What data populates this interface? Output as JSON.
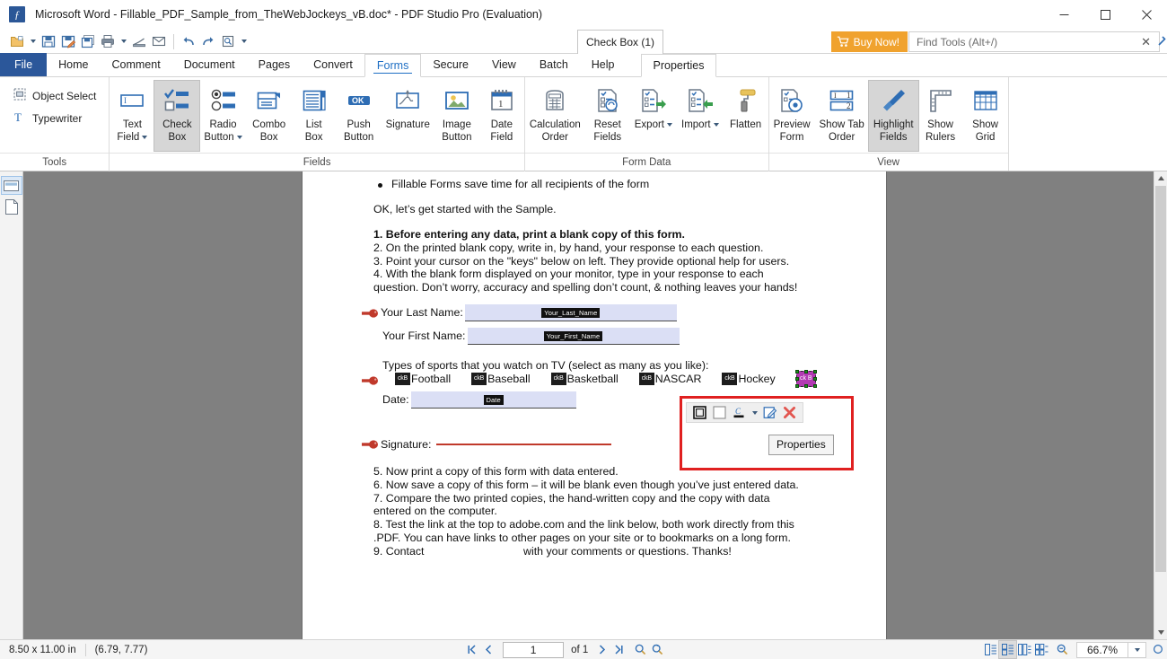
{
  "window": {
    "title": "Microsoft Word - Fillable_PDF_Sample_from_TheWebJockeys_vB.doc* - PDF Studio Pro (Evaluation)",
    "logo_glyph": "ƒ",
    "minimize": "─",
    "maximize": "□",
    "close": "✕"
  },
  "quick_access": {
    "buttons": [
      {
        "name": "open-file",
        "icon": "folder-open-icon"
      },
      {
        "name": "open-file-dropdown",
        "icon": "chevron-down-icon"
      },
      {
        "name": "save",
        "icon": "save-icon"
      },
      {
        "name": "save-as",
        "icon": "save-as-icon"
      },
      {
        "name": "save-all",
        "icon": "save-all-icon"
      },
      {
        "name": "print",
        "icon": "printer-icon"
      },
      {
        "name": "print-dropdown",
        "icon": "chevron-down-icon"
      },
      {
        "name": "scan",
        "icon": "scanner-icon"
      },
      {
        "name": "email",
        "icon": "envelope-icon"
      },
      {
        "name": "undo",
        "icon": "undo-arrow-icon"
      },
      {
        "name": "redo",
        "icon": "redo-arrow-icon"
      },
      {
        "name": "preview",
        "icon": "page-preview-icon"
      },
      {
        "name": "more-dropdown",
        "icon": "chevron-down-icon"
      }
    ],
    "document_selector": "Check Box (1)",
    "buy_now": "Buy Now!",
    "buy_now_color": "#f0a22e",
    "find_tools_placeholder": "Find Tools  (Alt+/)",
    "find_tools_value": "",
    "find_clear": "✕"
  },
  "tabs": {
    "items": [
      {
        "label": "File",
        "state": "file"
      },
      {
        "label": "Home",
        "state": "normal"
      },
      {
        "label": "Comment",
        "state": "normal"
      },
      {
        "label": "Document",
        "state": "normal"
      },
      {
        "label": "Pages",
        "state": "normal"
      },
      {
        "label": "Convert",
        "state": "normal"
      },
      {
        "label": "Forms",
        "state": "active"
      },
      {
        "label": "Secure",
        "state": "normal"
      },
      {
        "label": "View",
        "state": "normal"
      },
      {
        "label": "Batch",
        "state": "normal"
      },
      {
        "label": "Help",
        "state": "normal"
      }
    ],
    "contextual": "Properties",
    "active_accent": "#1f6fc4"
  },
  "ribbon": {
    "groups": [
      {
        "label": "Tools",
        "small_buttons": [
          {
            "label": "Object Select",
            "icon": "object-select-icon"
          },
          {
            "label": "Typewriter",
            "icon": "typewriter-icon"
          }
        ],
        "buttons": []
      },
      {
        "label": "Fields",
        "small_buttons": [],
        "buttons": [
          {
            "label": "Text\nField",
            "icon": "text-field-icon",
            "dropdown": true,
            "selected": false
          },
          {
            "label": "Check\nBox",
            "icon": "check-box-icon",
            "dropdown": false,
            "selected": true
          },
          {
            "label": "Radio\nButton",
            "icon": "radio-button-icon",
            "dropdown": true,
            "selected": false
          },
          {
            "label": "Combo\nBox",
            "icon": "combo-box-icon",
            "dropdown": false,
            "selected": false
          },
          {
            "label": "List\nBox",
            "icon": "list-box-icon",
            "dropdown": false,
            "selected": false
          },
          {
            "label": "Push\nButton",
            "icon": "push-button-icon",
            "dropdown": false,
            "selected": false
          },
          {
            "label": "Signature",
            "icon": "signature-icon",
            "dropdown": false,
            "selected": false
          },
          {
            "label": "Image\nButton",
            "icon": "image-button-icon",
            "dropdown": false,
            "selected": false
          },
          {
            "label": "Date\nField",
            "icon": "date-field-icon",
            "dropdown": false,
            "selected": false
          }
        ]
      },
      {
        "label": "Form Data",
        "small_buttons": [],
        "buttons": [
          {
            "label": "Calculation\nOrder",
            "icon": "calculator-icon",
            "dropdown": false,
            "selected": false
          },
          {
            "label": "Reset\nFields",
            "icon": "reset-fields-icon",
            "dropdown": false,
            "selected": false
          },
          {
            "label": "Export",
            "icon": "export-icon",
            "dropdown": true,
            "selected": false
          },
          {
            "label": "Import",
            "icon": "import-icon",
            "dropdown": true,
            "selected": false
          },
          {
            "label": "Flatten",
            "icon": "flatten-roller-icon",
            "dropdown": false,
            "selected": false
          }
        ]
      },
      {
        "label": "View",
        "small_buttons": [],
        "buttons": [
          {
            "label": "Preview\nForm",
            "icon": "preview-form-icon",
            "dropdown": false,
            "selected": false
          },
          {
            "label": "Show Tab\nOrder",
            "icon": "show-tab-order-icon",
            "dropdown": false,
            "selected": false
          },
          {
            "label": "Highlight\nFields",
            "icon": "highlighter-icon",
            "dropdown": false,
            "selected": true
          },
          {
            "label": "Show\nRulers",
            "icon": "ruler-icon",
            "dropdown": false,
            "selected": false
          },
          {
            "label": "Show\nGrid",
            "icon": "grid-icon",
            "dropdown": false,
            "selected": false
          }
        ]
      }
    ]
  },
  "sidebar_rail": [
    {
      "name": "bookmarks-panel",
      "icon": "panel-icon",
      "active": true
    },
    {
      "name": "pages-panel",
      "icon": "page-icon",
      "active": false
    }
  ],
  "document": {
    "bullet": "Fillable Forms save time for all recipients of the form",
    "intro": "OK, let’s get started with the Sample.",
    "steps_a": [
      "1. Before entering any data, print a blank copy of this form.",
      "2. On the printed blank copy, write in, by hand, your response to each question.",
      "3. Point your cursor on the \"keys\" below on left. They provide optional help for users.",
      "4. With the blank form displayed on your monitor, type in your response to each",
      "    question. Don’t worry, accuracy and spelling don’t count, & nothing leaves your hands!"
    ],
    "fields": [
      {
        "label": "Your Last Name:",
        "field_name": "Your_Last_Name",
        "has_key": true
      },
      {
        "label": "Your First Name:",
        "field_name": "Your_First_Name",
        "has_key": false
      }
    ],
    "sports_prompt": "Types of sports that you watch on TV (select as many as you like):",
    "sports": [
      {
        "label": "Football",
        "box_text": "ckB"
      },
      {
        "label": "Baseball",
        "box_text": "ckB"
      },
      {
        "label": "Basketball",
        "box_text": "ckB"
      },
      {
        "label": "NASCAR",
        "box_text": "ckB"
      },
      {
        "label": "Hockey",
        "box_text": "ckB"
      }
    ],
    "selected_checkbox": {
      "box_text": "ck B",
      "color": "#b23ab2"
    },
    "date": {
      "label": "Date:",
      "field_name": "Date"
    },
    "signature": {
      "label": "Signature:",
      "line_color": "#c0392b"
    },
    "steps_b": [
      "5. Now print a copy of this form with data entered.",
      "6. Now save a copy of this form – it will be blank even though you’ve just entered data.",
      "7. Compare the two printed copies, the hand-written copy and the copy with data",
      "entered on the computer.",
      "8. Test the link at the top to adobe.com and the link below, both work directly from this",
      " .PDF. You can have links to other pages on your site or to bookmarks on a long form.",
      "9. Contact"
    ],
    "contact_tail": "with your comments or questions.  Thanks!",
    "field_fill_color": "#dbdff5"
  },
  "popup": {
    "border_color": "#e02020",
    "tools": [
      {
        "name": "border-color-swatch",
        "icon": "square-outline-icon"
      },
      {
        "name": "fill-color-swatch",
        "icon": "square-filled-icon"
      },
      {
        "name": "text-color",
        "icon": "font-color-icon"
      },
      {
        "name": "edit-properties",
        "icon": "pencil-edit-icon"
      },
      {
        "name": "delete-field",
        "icon": "red-x-icon"
      }
    ],
    "tooltip": "Properties"
  },
  "status": {
    "page_size": "8.50 x 11.00 in",
    "cursor_position": "(6.79, 7.77)",
    "nav": {
      "first": "first-page-icon",
      "prev": "prev-page-icon",
      "page_value": "1",
      "of_label": "of 1",
      "next": "next-page-icon",
      "last": "last-page-icon",
      "zoom_out_tool": "zoom-out-icon",
      "zoom_in_tool": "zoom-in-icon"
    },
    "view_modes": [
      {
        "name": "single-page-mode",
        "active": false
      },
      {
        "name": "continuous-mode",
        "active": true
      },
      {
        "name": "two-page-mode",
        "active": false
      },
      {
        "name": "two-page-continuous-mode",
        "active": false
      }
    ],
    "zoom_out": "zoom-out-icon",
    "zoom_value": "66.7%",
    "zoom_caret": "chevron-down-icon"
  }
}
